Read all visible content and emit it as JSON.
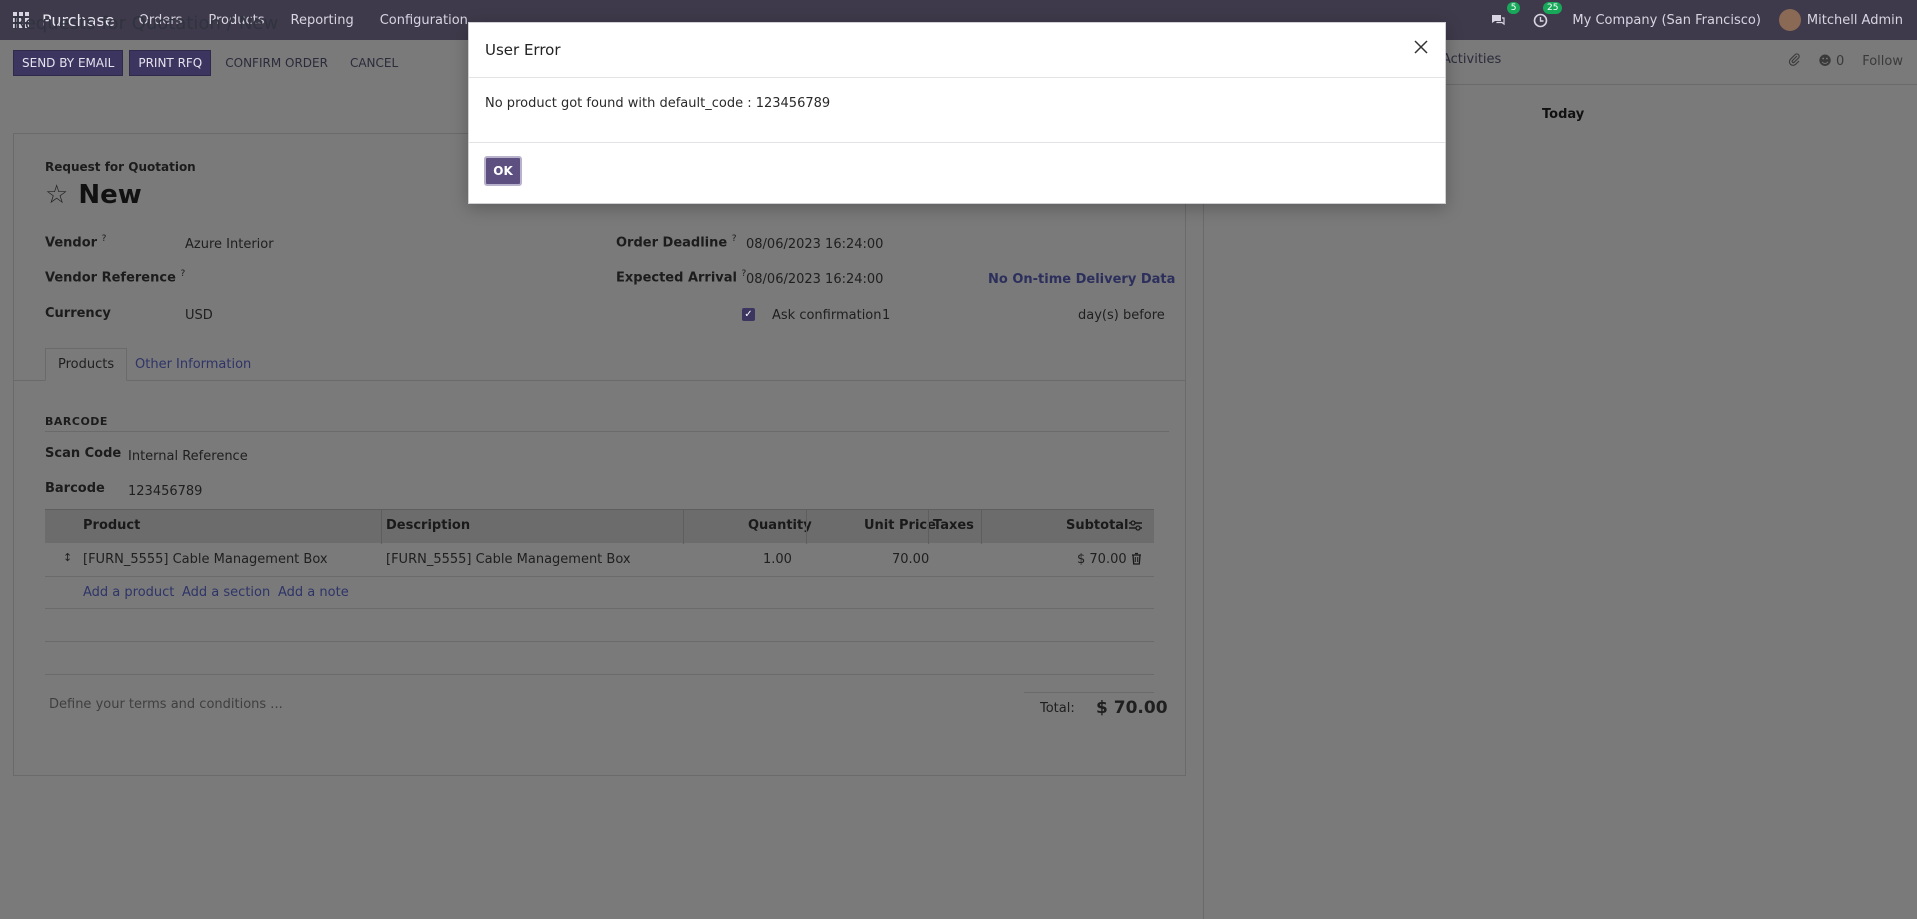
{
  "nav": {
    "brand": "Purchase",
    "menu": [
      "Orders",
      "Products",
      "Reporting",
      "Configuration"
    ],
    "messages_count": "5",
    "activities_count": "25",
    "company": "My Company (San Francisco)",
    "user": "Mitchell Admin"
  },
  "breadcrumb": {
    "parent": "Requests for Quotation",
    "separator": "/",
    "current": "New"
  },
  "actions": {
    "send_email": "SEND BY EMAIL",
    "print_rfq": "PRINT RFQ",
    "confirm_order": "CONFIRM ORDER",
    "cancel": "CANCEL"
  },
  "chatter": {
    "activities": "Activities",
    "followers": "0",
    "follow": "Follow",
    "today": "Today"
  },
  "form": {
    "doc_label": "Request for Quotation",
    "title": "New",
    "vendor_label": "Vendor",
    "vendor_value": "Azure Interior",
    "vendor_ref_label": "Vendor Reference",
    "currency_label": "Currency",
    "currency_value": "USD",
    "order_deadline_label": "Order Deadline",
    "order_deadline_value": "08/06/2023 16:24:00",
    "expected_arrival_label": "Expected Arrival",
    "expected_arrival_value": "08/06/2023 16:24:00",
    "on_time_link": "No On-time Delivery Data",
    "ask_confirmation_label": "Ask confirmation",
    "ask_confirmation_days": "1",
    "days_before": "day(s) before",
    "help_mark": "?"
  },
  "tabs": [
    "Products",
    "Other Information"
  ],
  "barcode": {
    "section": "BARCODE",
    "scan_code_label": "Scan Code",
    "scan_code_value": "Internal Reference",
    "barcode_label": "Barcode",
    "barcode_value": "123456789"
  },
  "table": {
    "headers": [
      "Product",
      "Description",
      "Quantity",
      "Unit Price",
      "Taxes",
      "Subtotal"
    ],
    "rows": [
      {
        "product": "[FURN_5555] Cable Management Box",
        "description": "[FURN_5555] Cable Management Box",
        "quantity": "1.00",
        "unit_price": "70.00",
        "taxes": "",
        "subtotal": "$ 70.00"
      }
    ],
    "add_product": "Add a product",
    "add_section": "Add a section",
    "add_note": "Add a note"
  },
  "footer": {
    "terms_placeholder": "Define your terms and conditions ...",
    "total_label": "Total:",
    "total_value": "$ 70.00"
  },
  "modal": {
    "title": "User Error",
    "message": "No product got found with default_code : 123456789",
    "ok": "OK"
  }
}
